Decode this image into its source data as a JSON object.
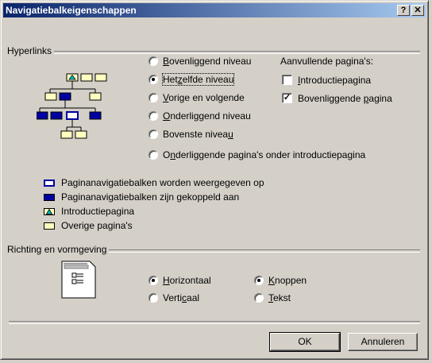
{
  "window": {
    "title": "Navigatiebalkeigenschappen",
    "help_btn": "?",
    "close_btn": "✕"
  },
  "hyperlinks": {
    "group_label": "Hyperlinks",
    "options": [
      {
        "pre": "",
        "ul": "B",
        "post": "ovenliggend niveau",
        "selected": false
      },
      {
        "pre": "Het",
        "ul": "z",
        "post": "elfde niveau",
        "selected": true
      },
      {
        "pre": "",
        "ul": "V",
        "post": "orige en volgende",
        "selected": false
      },
      {
        "pre": "",
        "ul": "O",
        "post": "nderliggend niveau",
        "selected": false
      },
      {
        "pre": "Bovenste nivea",
        "ul": "u",
        "post": "",
        "selected": false
      },
      {
        "pre": "O",
        "ul": "n",
        "post": "derliggende pagina's onder introductiepagina",
        "selected": false
      }
    ],
    "additional": {
      "label": "Aanvullende pagina's:",
      "items": [
        {
          "pre": "",
          "ul": "I",
          "post": "ntroductiepagina",
          "checked": false
        },
        {
          "pre": "Bovenliggende ",
          "ul": "p",
          "post": "agina",
          "checked": true
        }
      ]
    },
    "legend": [
      {
        "text": "Paginanavigatiebalken worden weergegeven op",
        "swatch": "outline"
      },
      {
        "text": "Paginanavigatiebalken zijn gekoppeld aan",
        "swatch": "filled"
      },
      {
        "text": "Introductiepagina",
        "swatch": "home"
      },
      {
        "text": "Overige pagina's",
        "swatch": "plain"
      }
    ]
  },
  "orientation": {
    "group_label": "Richting en vormgeving",
    "direction": [
      {
        "pre": "",
        "ul": "H",
        "post": "orizontaal",
        "selected": true
      },
      {
        "pre": "Verti",
        "ul": "c",
        "post": "aal",
        "selected": false
      }
    ],
    "style": [
      {
        "pre": "",
        "ul": "K",
        "post": "noppen",
        "selected": true
      },
      {
        "pre": "",
        "ul": "T",
        "post": "ekst",
        "selected": false
      }
    ]
  },
  "buttons": {
    "ok": "OK",
    "cancel": "Annuleren"
  },
  "colors": {
    "title_start": "#0a246a",
    "title_end": "#a6caf0",
    "nav_blue": "#0000a0",
    "page_yellow": "#ffffc0",
    "home_cyan": "#00c0c0"
  }
}
